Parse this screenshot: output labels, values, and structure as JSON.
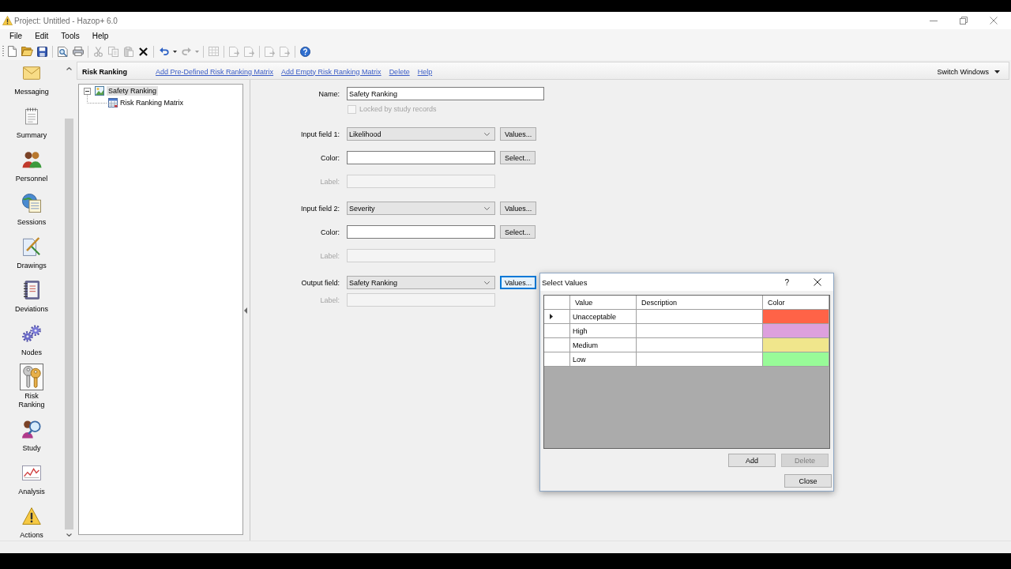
{
  "window": {
    "title": "Project: Untitled - Hazop+ 6.0"
  },
  "menu": [
    {
      "label": "File"
    },
    {
      "label": "Edit"
    },
    {
      "label": "Tools"
    },
    {
      "label": "Help"
    }
  ],
  "toolbar": [
    {
      "kind": "new",
      "disabled": false
    },
    {
      "kind": "open",
      "disabled": false
    },
    {
      "kind": "save",
      "disabled": false
    },
    {
      "kind": "separator"
    },
    {
      "kind": "print-preview",
      "disabled": false
    },
    {
      "kind": "print",
      "disabled": false
    },
    {
      "kind": "separator"
    },
    {
      "kind": "cut",
      "disabled": true
    },
    {
      "kind": "copy",
      "disabled": true
    },
    {
      "kind": "paste",
      "disabled": true
    },
    {
      "kind": "delete",
      "disabled": false
    },
    {
      "kind": "separator"
    },
    {
      "kind": "undo",
      "disabled": false
    },
    {
      "kind": "dropdown",
      "disabled": false
    },
    {
      "kind": "redo",
      "disabled": true
    },
    {
      "kind": "dropdown",
      "disabled": true
    },
    {
      "kind": "separator"
    },
    {
      "kind": "table",
      "disabled": true
    },
    {
      "kind": "separator"
    },
    {
      "kind": "page",
      "disabled": true
    },
    {
      "kind": "page",
      "disabled": true
    },
    {
      "kind": "separator"
    },
    {
      "kind": "page",
      "disabled": true
    },
    {
      "kind": "page",
      "disabled": true
    },
    {
      "kind": "separator"
    },
    {
      "kind": "help",
      "disabled": false
    }
  ],
  "sidebar": {
    "items": [
      {
        "label": "Messaging",
        "kind": "messaging",
        "selected": false
      },
      {
        "label": "Summary",
        "kind": "summary",
        "selected": false
      },
      {
        "label": "Personnel",
        "kind": "personnel",
        "selected": false
      },
      {
        "label": "Sessions",
        "kind": "sessions",
        "selected": false
      },
      {
        "label": "Drawings",
        "kind": "drawings",
        "selected": false
      },
      {
        "label": "Deviations",
        "kind": "deviations",
        "selected": false
      },
      {
        "label": "Nodes",
        "kind": "nodes",
        "selected": false
      },
      {
        "label": "Risk Ranking",
        "kind": "risk-ranking",
        "selected": true
      },
      {
        "label": "Study",
        "kind": "study",
        "selected": false
      },
      {
        "label": "Analysis",
        "kind": "analysis",
        "selected": false
      },
      {
        "label": "Actions",
        "kind": "actions",
        "selected": false
      }
    ]
  },
  "panel": {
    "title": "Risk Ranking",
    "links": [
      "Add Pre-Defined Risk Ranking Matrix",
      "Add Empty Risk Ranking Matrix",
      "Delete",
      "Help"
    ],
    "switch_windows": "Switch Windows"
  },
  "tree": [
    {
      "label": "Safety Ranking",
      "kind": "ranking",
      "expanded": true,
      "selected": true,
      "children": [
        {
          "label": "Risk Ranking Matrix",
          "kind": "matrix",
          "selected": false
        }
      ]
    }
  ],
  "form": {
    "groups": [
      [
        {
          "kind": "text",
          "label": "Name:",
          "value": "Safety Ranking",
          "disabled": false
        },
        {
          "kind": "checkbox",
          "label": "Locked by study records",
          "checked": false,
          "disabled": true
        }
      ],
      [
        {
          "kind": "combo",
          "label": "Input field 1:",
          "value": "Likelihood",
          "disabled": false,
          "button": {
            "label": "Values...",
            "focused": false
          }
        },
        {
          "kind": "color",
          "label": "Color:",
          "disabled": false,
          "button": {
            "label": "Select...",
            "focused": false
          }
        },
        {
          "kind": "label",
          "label": "Label:",
          "disabled": true
        }
      ],
      [
        {
          "kind": "combo",
          "label": "Input field 2:",
          "value": "Severity",
          "disabled": false,
          "button": {
            "label": "Values...",
            "focused": false
          }
        },
        {
          "kind": "color",
          "label": "Color:",
          "disabled": false,
          "button": {
            "label": "Select...",
            "focused": false
          }
        },
        {
          "kind": "label",
          "label": "Label:",
          "disabled": true
        }
      ],
      [
        {
          "kind": "combo",
          "label": "Output field:",
          "value": "Safety Ranking",
          "disabled": false,
          "button": {
            "label": "Values...",
            "focused": true
          }
        },
        {
          "kind": "label",
          "label": "Label:",
          "disabled": true
        }
      ]
    ]
  },
  "dialog": {
    "title": "Select Values",
    "help": "?",
    "columns": [
      "Value",
      "Description",
      "Color"
    ],
    "rows": [
      {
        "value": "Unacceptable",
        "color": "#ff6347",
        "selected": true
      },
      {
        "value": "High",
        "color": "#dda0dd",
        "selected": false
      },
      {
        "value": "Medium",
        "color": "#f0e68c",
        "selected": false
      },
      {
        "value": "Low",
        "color": "#98fb98",
        "selected": false
      }
    ],
    "actions": [
      {
        "label": "Add",
        "disabled": false
      },
      {
        "label": "Delete",
        "disabled": true
      }
    ],
    "close_button": {
      "label": "Close"
    }
  }
}
